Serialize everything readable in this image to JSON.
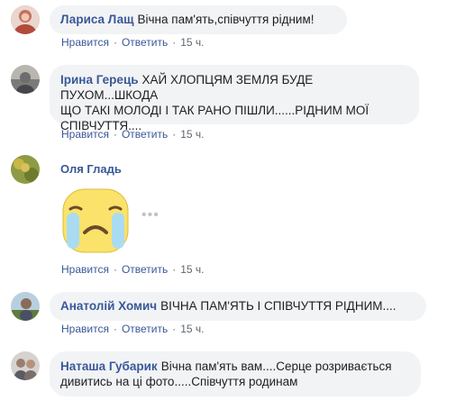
{
  "comments": [
    {
      "author": "Лариса Лащ",
      "text": "Вічна пам'ять,співчуття рідним!",
      "actions": {
        "like": "Нравится",
        "reply": "Ответить",
        "time": "15 ч."
      }
    },
    {
      "author": "Ірина Герець",
      "text_lines": [
        "ХАЙ ХЛОПЦЯМ ЗЕМЛЯ БУДЕ ПУХОМ...ШКОДА",
        "ЩО ТАКІ МОЛОДІ І ТАК РАНО ПІШЛИ......РІДНИМ МОЇ",
        "СПІВЧУТТЯ...."
      ],
      "actions": {
        "like": "Нравится",
        "reply": "Ответить",
        "time": "15 ч."
      }
    },
    {
      "author": "Оля Гладь",
      "sticker": "crying-face-sticker",
      "actions": {
        "like": "Нравится",
        "reply": "Ответить",
        "time": "15 ч."
      }
    },
    {
      "author": "Анатолій Хомич",
      "text": "ВІЧНА ПАМ'ЯТЬ І СПІВЧУТТЯ РІДНИМ....",
      "actions": {
        "like": "Нравится",
        "reply": "Ответить",
        "time": "15 ч."
      }
    },
    {
      "author": "Наташа Губарик",
      "text_lines": [
        "Вічна пам'ять вам....Серце розривається",
        "дивитись на ці фото.....Співчуття родинам"
      ]
    }
  ],
  "colors": {
    "link": "#385898",
    "bubble": "#f2f3f5",
    "meta": "#606770"
  }
}
